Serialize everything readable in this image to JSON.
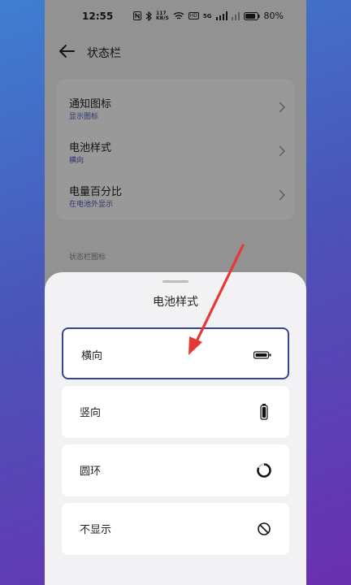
{
  "status_bar": {
    "time": "12:55",
    "network_speed": "117\nKB/S",
    "signal_labels": [
      "HD",
      "5G"
    ],
    "battery_percent": "80%"
  },
  "header": {
    "title": "状态栏"
  },
  "settings": {
    "items": [
      {
        "title": "通知图标",
        "subtitle": "显示图标"
      },
      {
        "title": "电池样式",
        "subtitle": "横向"
      },
      {
        "title": "电量百分比",
        "subtitle": "在电池外显示"
      }
    ],
    "section_label": "状态栏图标"
  },
  "sheet": {
    "title": "电池样式",
    "options": [
      {
        "label": "横向",
        "icon": "battery-horizontal-icon",
        "selected": true
      },
      {
        "label": "竖向",
        "icon": "battery-vertical-icon",
        "selected": false
      },
      {
        "label": "圆环",
        "icon": "battery-ring-icon",
        "selected": false
      },
      {
        "label": "不显示",
        "icon": "hidden-icon",
        "selected": false
      }
    ]
  },
  "colors": {
    "accent": "#4b57b8",
    "selected_border": "#3b4290",
    "annotation_arrow": "#e53935"
  }
}
